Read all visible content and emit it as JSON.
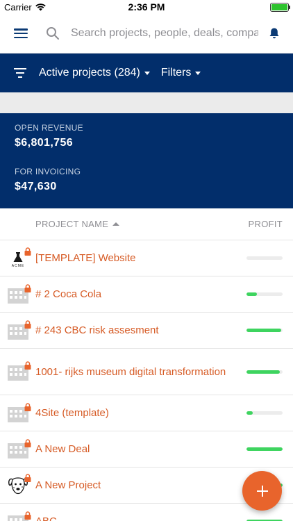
{
  "status_bar": {
    "carrier": "Carrier",
    "time": "2:36 PM"
  },
  "top_bar": {
    "search_placeholder": "Search projects, people, deals, compa"
  },
  "filter_bar": {
    "view_label": "Active projects (284)",
    "filters_label": "Filters"
  },
  "summary": {
    "open_revenue_label": "OPEN REVENUE",
    "open_revenue_value": "$6,801,756",
    "for_invoicing_label": "FOR INVOICING",
    "for_invoicing_value": "$47,630"
  },
  "table": {
    "col_project": "PROJECT NAME",
    "col_profit": "PROFIT",
    "rows": [
      {
        "name": "[TEMPLATE] Website",
        "icon": "acme-logo-icon",
        "profit": 0
      },
      {
        "name": "# 2 Coca Cola",
        "icon": "building-icon",
        "profit": 0.28
      },
      {
        "name": "# 243 CBC risk assesment",
        "icon": "building-icon",
        "profit": 0.96
      },
      {
        "name": "1001- rijks museum digital transformation",
        "icon": "building-icon",
        "profit": 0.92
      },
      {
        "name": "4Site (template)",
        "icon": "building-icon",
        "profit": 0.18
      },
      {
        "name": "A New Deal",
        "icon": "building-icon",
        "profit": 1.0
      },
      {
        "name": "A New Project",
        "icon": "dog-avatar-icon",
        "profit": 1.0
      },
      {
        "name": "ABC",
        "icon": "building-icon",
        "profit": 1.0
      }
    ]
  },
  "colors": {
    "navy": "#022e6b",
    "accent": "#e8642c",
    "link": "#d65a24",
    "profit_green": "#3ed45f"
  }
}
